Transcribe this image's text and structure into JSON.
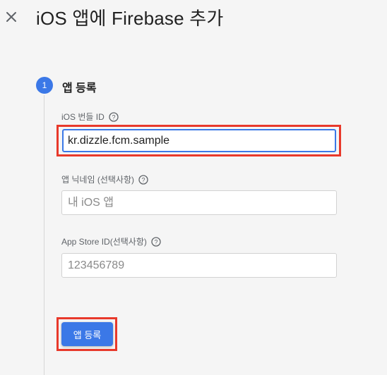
{
  "header": {
    "title": "iOS 앱에 Firebase 추가",
    "close_icon": "close-icon"
  },
  "step": {
    "number": "1",
    "title": "앱 등록",
    "accent_color": "#3b78e7"
  },
  "form": {
    "bundle_id": {
      "label": "iOS 번들 ID",
      "value": "kr.dizzle.fcm.sample",
      "help_icon": "help-circle-icon"
    },
    "nickname": {
      "label": "앱 닉네임 (선택사항)",
      "placeholder": "내 iOS 앱",
      "help_icon": "help-circle-icon"
    },
    "app_store_id": {
      "label": "App Store ID(선택사항)",
      "placeholder": "123456789",
      "help_icon": "help-circle-icon"
    },
    "register_button": "앱 등록"
  },
  "annotation_color": "#e8392b"
}
